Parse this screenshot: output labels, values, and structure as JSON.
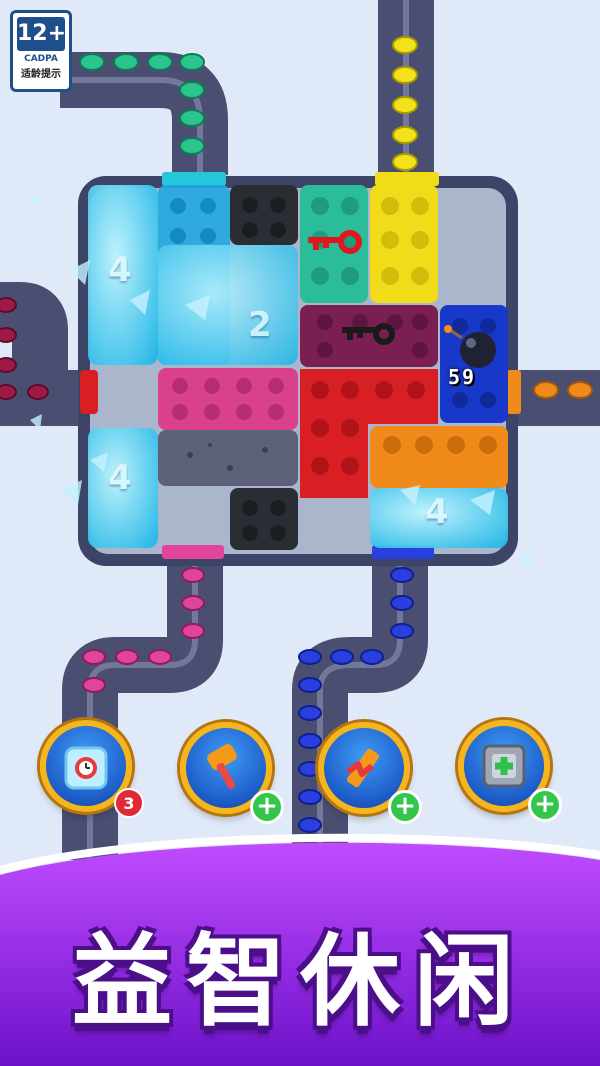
{
  "rating": {
    "age": "12+",
    "org": "CADPA",
    "tip": "适龄提示"
  },
  "board": {
    "timer": "59",
    "ice_numbers": [
      "4",
      "2",
      "4",
      "4"
    ]
  },
  "boosters": [
    {
      "name": "freeze-clock",
      "count": "3"
    },
    {
      "name": "hammer",
      "plus": "+"
    },
    {
      "name": "saw",
      "plus": "+"
    },
    {
      "name": "shuffle-box",
      "plus": "+"
    }
  ],
  "banner": {
    "title": "益智休闲"
  },
  "colors": {
    "background": "#dfe9f7",
    "track": "#4a4f72",
    "board": "#3c4468",
    "cyan": "#13b5dd",
    "black": "#2a2d34",
    "teal": "#2bbd9a",
    "yellow": "#f2dc1a",
    "purple": "#7b1f52",
    "blue": "#1738c9",
    "pink": "#d9418f",
    "red": "#d91f24",
    "orange": "#f08a1a",
    "banner": "#8a1fd6"
  }
}
